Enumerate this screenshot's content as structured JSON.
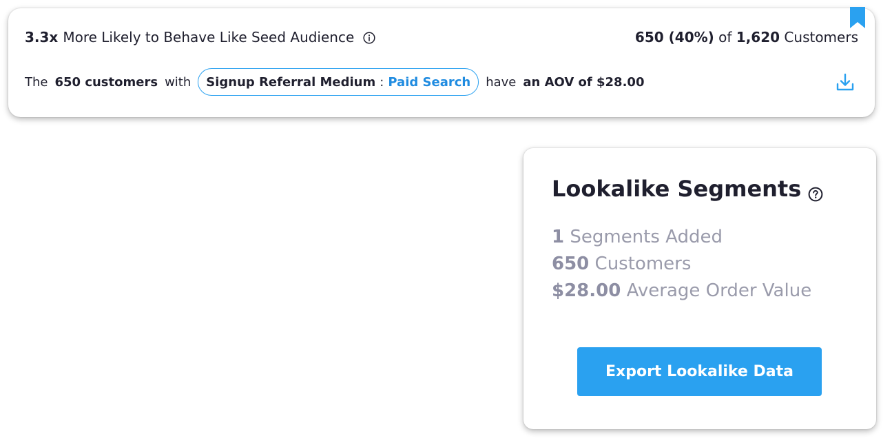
{
  "segment": {
    "multiplier": "3.3x",
    "headline": "More Likely to Behave Like Seed Audience",
    "count_pct": "650 (40%)",
    "of_word": "of",
    "total": "1,620",
    "total_suffix": "Customers",
    "sentence_prefix": "The",
    "customers_count": "650 customers",
    "with_word": "with",
    "attribute_key": "Signup Referral Medium",
    "attribute_separator": ":",
    "attribute_value": "Paid Search",
    "have_word": "have",
    "aov_text": "an AOV of $28.00"
  },
  "lookalike": {
    "title": "Lookalike Segments",
    "stats": [
      {
        "value": "1",
        "label": "Segments Added"
      },
      {
        "value": "650",
        "label": "Customers"
      },
      {
        "value": "$28.00",
        "label": "Average Order Value"
      }
    ],
    "export_label": "Export Lookalike Data"
  },
  "icons": {
    "info": "info-circle-icon",
    "download": "download-icon",
    "bookmark": "bookmark-icon",
    "help": "question-circle-icon"
  },
  "colors": {
    "accent": "#2aa1f0",
    "pill_value": "#1f8be0",
    "muted_text": "#9a9bab",
    "text": "#1f1f2e"
  }
}
